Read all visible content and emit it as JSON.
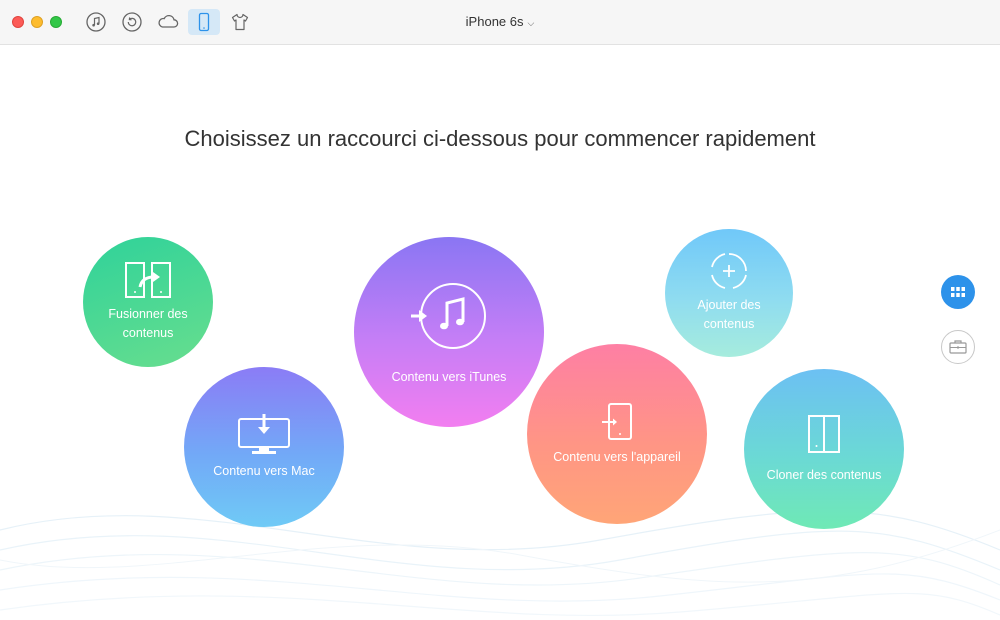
{
  "toolbar": {
    "items": [
      {
        "icon": "music-note-icon"
      },
      {
        "icon": "backup-restore-icon"
      },
      {
        "icon": "cloud-icon"
      },
      {
        "icon": "iphone-icon",
        "active": true
      },
      {
        "icon": "tshirt-icon"
      }
    ],
    "device_name": "iPhone 6s"
  },
  "main": {
    "headline": "Choisissez un raccourci ci-dessous pour commencer rapidement",
    "shortcuts": {
      "merge": "Fusionner des\ncontenus",
      "to_mac": "Contenu vers Mac",
      "to_itunes": "Contenu vers iTunes",
      "to_device": "Contenu vers l'appareil",
      "add": "Ajouter des\ncontenus",
      "clone": "Cloner des contenus"
    }
  },
  "colors": {
    "accent": "#2d92ea",
    "active_tab_bg": "#d5e8f7"
  }
}
